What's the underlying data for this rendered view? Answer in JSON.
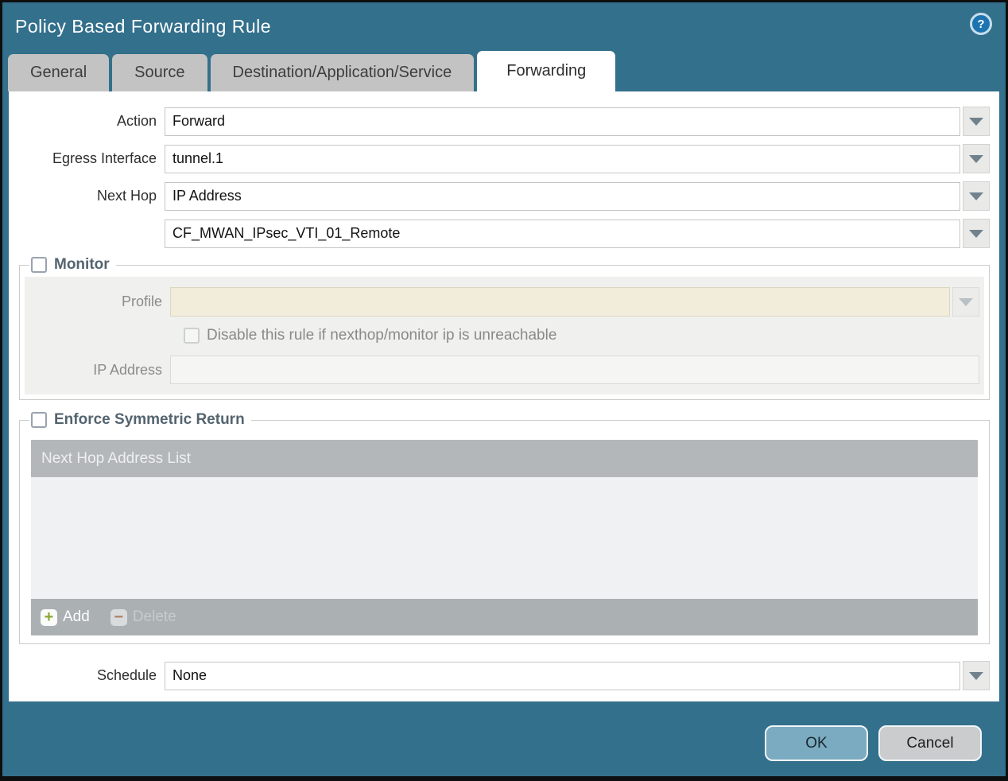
{
  "window": {
    "title": "Policy Based Forwarding Rule"
  },
  "tabs": [
    {
      "label": "General",
      "active": false
    },
    {
      "label": "Source",
      "active": false
    },
    {
      "label": "Destination/Application/Service",
      "active": false
    },
    {
      "label": "Forwarding",
      "active": true
    }
  ],
  "form": {
    "action": {
      "label": "Action",
      "value": "Forward"
    },
    "egress_interface": {
      "label": "Egress Interface",
      "value": "tunnel.1"
    },
    "next_hop": {
      "label": "Next Hop",
      "value": "IP Address"
    },
    "next_hop_address": {
      "value": "CF_MWAN_IPsec_VTI_01_Remote"
    },
    "schedule": {
      "label": "Schedule",
      "value": "None"
    }
  },
  "monitor": {
    "legend": "Monitor",
    "checked": false,
    "profile": {
      "label": "Profile",
      "value": ""
    },
    "disable_rule": {
      "label": "Disable this rule if nexthop/monitor ip is unreachable",
      "checked": false
    },
    "ip_address": {
      "label": "IP Address",
      "value": ""
    }
  },
  "symmetric_return": {
    "legend": "Enforce Symmetric Return",
    "checked": false,
    "table": {
      "header": "Next Hop Address List",
      "rows": []
    },
    "add_label": "Add",
    "delete_label": "Delete"
  },
  "footer": {
    "ok": "OK",
    "cancel": "Cancel"
  },
  "icons": {
    "help": "?",
    "plus": "+",
    "minus": "−"
  },
  "colors": {
    "titlebar_teal": "#33708c",
    "tab_gray": "#c3c3c3",
    "active_tab": "#ffffff",
    "disabled_field_beige": "#f2ecda",
    "table_header_gray": "#b3b7b9",
    "footer_bar_gray": "#abb0b3",
    "add_plus_green": "#8aaa38",
    "delete_minus_brown": "#ab8065",
    "ok_button_blue": "#7babc0",
    "cancel_button_gray": "#cbcccd"
  }
}
